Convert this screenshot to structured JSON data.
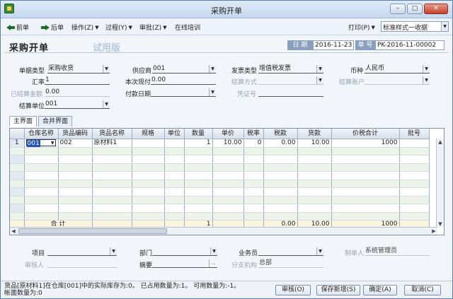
{
  "window": {
    "title": "采购开单",
    "buttons": [
      "–",
      "▢",
      "✕"
    ]
  },
  "toolbar": {
    "prev": "前单",
    "next": "后单",
    "operation": "操作(Z)",
    "process": "过程(Y)",
    "approve": "审批(Z)",
    "training": "在线培训",
    "print": "打印(P)",
    "style_value": "标准样式一收据"
  },
  "header": {
    "title": "采购开单",
    "trial": "试用版",
    "date_label": "日 期",
    "date_value": "2016-11-23",
    "no_label": "单 号",
    "no_value": "PK-2016-11-00002"
  },
  "form": {
    "doc_type_label": "单据类型",
    "doc_type_value": "采购收货",
    "supplier_label": "供应商",
    "supplier_value": "001",
    "invoice_type_label": "发票类型",
    "invoice_type_value": "增值税发票",
    "currency_label": "币种",
    "currency_value": "人民币",
    "rate_label": "汇率",
    "rate_value": "1",
    "paid_label": "本次现付",
    "paid_value": "0.00",
    "settle_method_label": "结算方式",
    "settle_method_value": "",
    "settle_account_label": "结算账户",
    "settle_account_value": "",
    "settled_label": "已结算金额",
    "settled_value": "0.00",
    "pay_date_label": "付款日期",
    "pay_date_value": "",
    "voucher_label": "凭证号",
    "voucher_value": "",
    "settle_unit_label": "结算单位",
    "settle_unit_value": "001"
  },
  "tabs": [
    "主界面",
    "合并界面"
  ],
  "table": {
    "columns": [
      "仓库名称",
      "货品编码",
      "货品名称",
      "规格",
      "单位",
      "数量",
      "单价",
      "税率",
      "税款",
      "货款",
      "价税合计",
      "批号"
    ],
    "rows": [
      {
        "idx": "1",
        "warehouse": "001",
        "code": "002",
        "name": "原材料1",
        "spec": "",
        "unit": "",
        "qty": "1",
        "price": "10.00",
        "tax_rate": "0",
        "tax": "0.00",
        "amount": "10.00",
        "total": "1000"
      }
    ],
    "total": {
      "label": "合 计",
      "qty": "1",
      "tax": "0.00",
      "amount": "10.00",
      "total": "1000"
    }
  },
  "footer": {
    "project_label": "项目",
    "dept_label": "部门",
    "salesman_label": "业务员",
    "maker_label": "制单人",
    "maker_value": "系统管理员",
    "reviewer_label": "审核人",
    "summary_label": "摘要",
    "branch_label": "分支机构",
    "branch_value": "总部"
  },
  "status": {
    "line1": "货品[原材料1]在仓库[001]中的实际库存为:0。 已占用数量为:1。 可用数量为:-1。",
    "line2": "帐面数量为:0"
  },
  "buttons": {
    "review": "审核(O)",
    "save_new": "保存新增(S)",
    "ok": "确定(A)",
    "cancel": "取消(C)"
  }
}
